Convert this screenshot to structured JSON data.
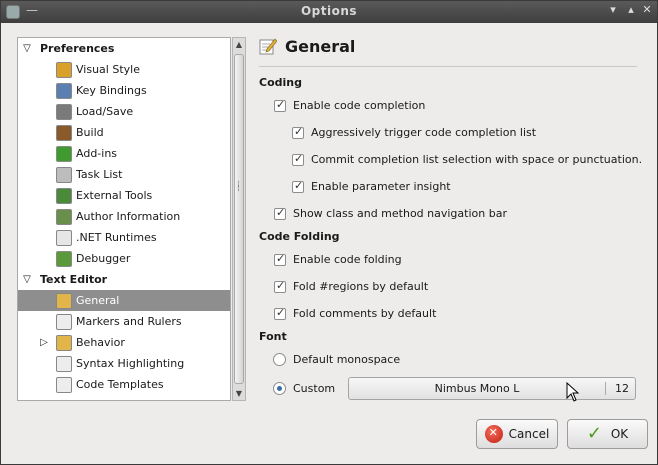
{
  "window": {
    "title": "Options"
  },
  "tree": {
    "items": [
      {
        "label": "Preferences",
        "category": true,
        "expand": "▽",
        "icon": "preferences-folder-icon"
      },
      {
        "label": "Visual Style",
        "icon": "visual-style-icon",
        "color": "#d9a02a"
      },
      {
        "label": "Key Bindings",
        "icon": "key-bindings-icon",
        "color": "#5b7fb0"
      },
      {
        "label": "Load/Save",
        "icon": "load-save-icon",
        "color": "#7a7a7a"
      },
      {
        "label": "Build",
        "icon": "build-icon",
        "color": "#8a5a2a"
      },
      {
        "label": "Add-ins",
        "icon": "add-ins-icon",
        "color": "#3f9a2f"
      },
      {
        "label": "Task List",
        "icon": "task-list-icon",
        "color": "#bdbdbd"
      },
      {
        "label": "External Tools",
        "icon": "external-tools-icon",
        "color": "#4a8a3a"
      },
      {
        "label": "Author Information",
        "icon": "author-information-icon",
        "color": "#6a8f4a"
      },
      {
        "label": ".NET Runtimes",
        "icon": "net-runtimes-icon",
        "color": "#e6e6e6"
      },
      {
        "label": "Debugger",
        "icon": "debugger-icon",
        "color": "#5a9a3a"
      },
      {
        "label": "Text Editor",
        "category": true,
        "expand": "▽",
        "icon": "text-editor-folder-icon"
      },
      {
        "label": "General",
        "icon": "general-icon",
        "color": "#e2b54a",
        "selected": true
      },
      {
        "label": "Markers and Rulers",
        "icon": "markers-rulers-icon",
        "color": "#ededed"
      },
      {
        "label": "Behavior",
        "icon": "behavior-icon",
        "color": "#e2b54a",
        "expand": "▷"
      },
      {
        "label": "Syntax Highlighting",
        "icon": "syntax-highlighting-icon",
        "color": "#ededed"
      },
      {
        "label": "Code Templates",
        "icon": "code-templates-icon",
        "color": "#ededed"
      }
    ]
  },
  "panel": {
    "title": "General",
    "sections": {
      "coding": "Coding",
      "folding": "Code Folding",
      "font": "Font"
    },
    "options": {
      "enable_completion": {
        "label": "Enable code completion",
        "checked": true
      },
      "aggressive_trigger": {
        "label": "Aggressively trigger code completion list",
        "checked": true
      },
      "commit_selection": {
        "label": "Commit completion list selection with space or punctuation.",
        "checked": true
      },
      "param_insight": {
        "label": "Enable parameter insight",
        "checked": true
      },
      "nav_bar": {
        "label": "Show class and method navigation bar",
        "checked": true
      },
      "enable_folding": {
        "label": "Enable code folding",
        "checked": true
      },
      "fold_regions": {
        "label": "Fold #regions by default",
        "checked": true
      },
      "fold_comments": {
        "label": "Fold comments by default",
        "checked": true
      }
    },
    "font": {
      "default_label": "Default monospace",
      "custom_label": "Custom",
      "selected": "custom",
      "font_name": "Nimbus Mono L",
      "font_size": "12"
    }
  },
  "buttons": {
    "cancel": "Cancel",
    "ok": "OK"
  }
}
